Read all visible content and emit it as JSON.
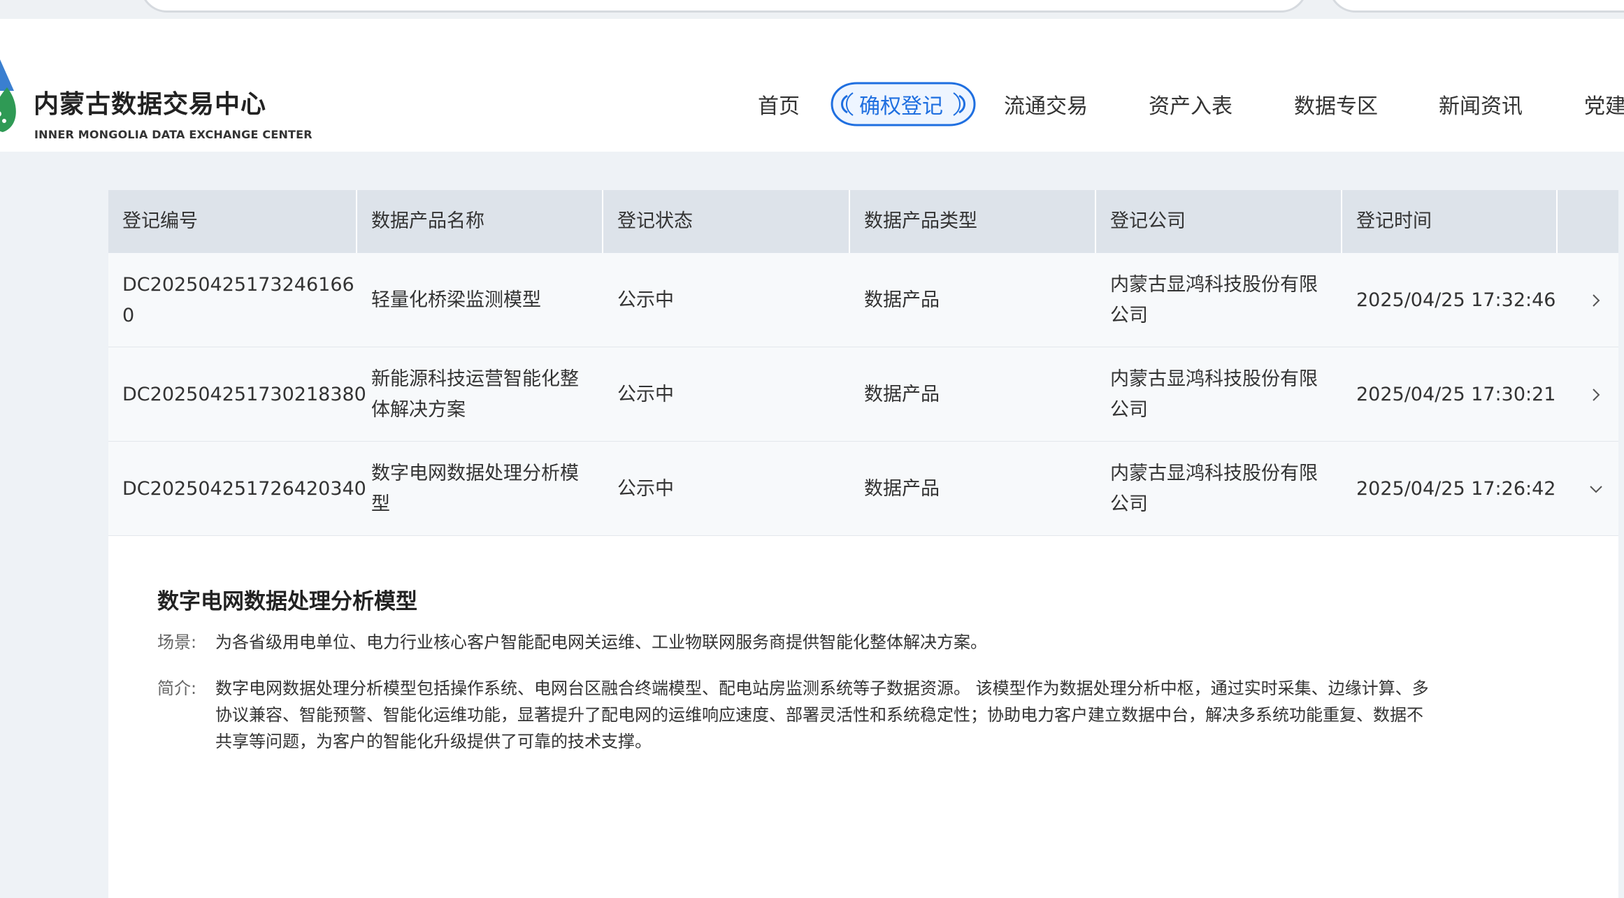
{
  "header": {
    "logo_cn": "内蒙古数据交易中心",
    "logo_en": "INNER MONGOLIA DATA EXCHANGE CENTER",
    "nav": [
      {
        "label": "首页",
        "active": false
      },
      {
        "label": "确权登记",
        "active": true
      },
      {
        "label": "流通交易",
        "active": false
      },
      {
        "label": "资产入表",
        "active": false
      },
      {
        "label": "数据专区",
        "active": false
      },
      {
        "label": "新闻资讯",
        "active": false
      },
      {
        "label": "党建",
        "active": false
      }
    ]
  },
  "table": {
    "columns": [
      "登记编号",
      "数据产品名称",
      "登记状态",
      "数据产品类型",
      "登记公司",
      "登记时间"
    ],
    "rows": [
      {
        "id": "DC20250425173246166​0",
        "name": "轻量化桥梁监测模型",
        "status": "公示中",
        "type": "数据产品",
        "company": "内蒙古显鸿科技股份有限公司",
        "time": "2025/04/25 17:32:46",
        "chevron": "chevron-right-icon"
      },
      {
        "id": "DC202504251730218380",
        "name": "新能源科技运营智能化整体解决方案",
        "status": "公示中",
        "type": "数据产品",
        "company": "内蒙古显鸿科技股份有限公司",
        "time": "2025/04/25 17:30:21",
        "chevron": "chevron-right-icon"
      },
      {
        "id": "DC202504251726420340",
        "name": "数字电网数据处理分析模型",
        "status": "公示中",
        "type": "数据产品",
        "company": "内蒙古显鸿科技股份有限公司",
        "time": "2025/04/25 17:26:42",
        "chevron": "chevron-down-icon"
      }
    ]
  },
  "detail": {
    "title": "数字电网数据处理分析模型",
    "scene_label": "场景:",
    "scene_text": "为各省级用电单位、电力行业核心客户智能配电网关运维、工业物联网服务商提供智能化整体解决方案。",
    "intro_label": "简介:",
    "intro_text": "数字电网数据处理分析模型包括操作系统、电网台区融合终端模型、配电站房监测系统等子数据资源。 该模型作为数据处理分析中枢，通过实时采集、边缘计算、多协议兼容、智能预警、智能化运维功能，显著提升了配电网的运维响应速度、部署灵活性和系统稳定性；协助电力客户建立数据中台，解决多系统功能重复、数据不共享等问题，为客户的智能化升级提供了可靠的技术支撑。"
  },
  "colors": {
    "accent": "#1f6fe0",
    "header_row": "#dde3ea",
    "page_bg": "#eef2f6",
    "row_bg": "#f7f9fb"
  }
}
